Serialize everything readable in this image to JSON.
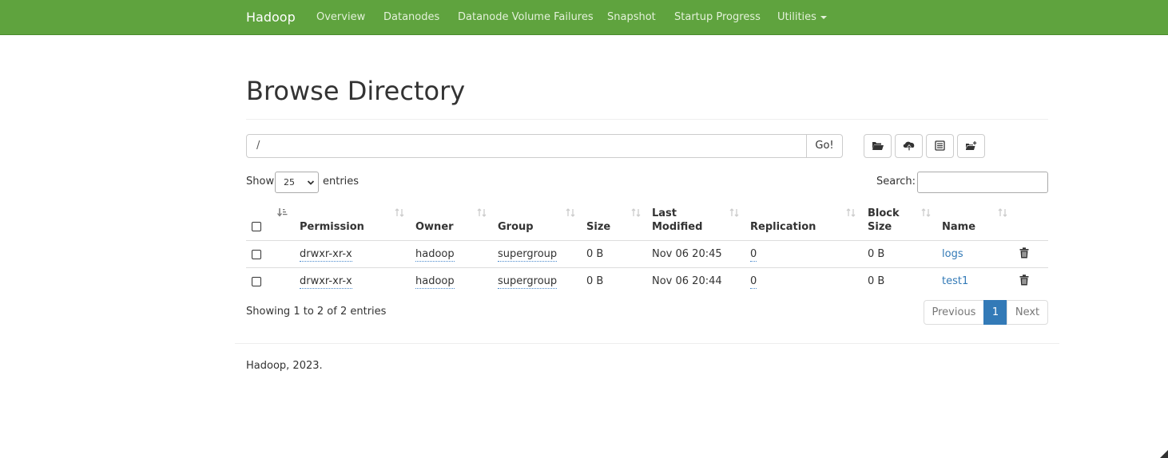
{
  "navbar": {
    "brand": "Hadoop",
    "links": [
      "Overview",
      "Datanodes",
      "Datanode Volume Failures",
      "Snapshot",
      "Startup Progress",
      "Utilities"
    ],
    "background_color": "#5fa33e"
  },
  "page": {
    "title": "Browse Directory"
  },
  "path_bar": {
    "value": "/",
    "go_label": "Go!",
    "tool_icons": [
      "folder-open-icon",
      "cloud-upload-icon",
      "list-alt-icon",
      "folder-plus-icon"
    ]
  },
  "controls": {
    "show_label": "Show",
    "page_size": "25",
    "entries_label": "entries",
    "search_label": "Search:",
    "search_value": ""
  },
  "table": {
    "headers": [
      "Permission",
      "Owner",
      "Group",
      "Size",
      "Last",
      "Modified",
      "Replication",
      "Block",
      "Size",
      "Name"
    ],
    "rows": [
      {
        "permission": "drwxr-xr-x",
        "owner": "hadoop",
        "group": "supergroup",
        "size": "0 B",
        "last_modified": "Nov 06 20:45",
        "replication": "0",
        "block_size": "0 B",
        "name": "logs"
      },
      {
        "permission": "drwxr-xr-x",
        "owner": "hadoop",
        "group": "supergroup",
        "size": "0 B",
        "last_modified": "Nov 06 20:44",
        "replication": "0",
        "block_size": "0 B",
        "name": "test1"
      }
    ]
  },
  "pagination": {
    "info": "Showing 1 to 2 of 2 entries",
    "previous": "Previous",
    "current_page": "1",
    "next": "Next",
    "active_color": "#337ab7"
  },
  "footer": {
    "text": "Hadoop, 2023."
  }
}
